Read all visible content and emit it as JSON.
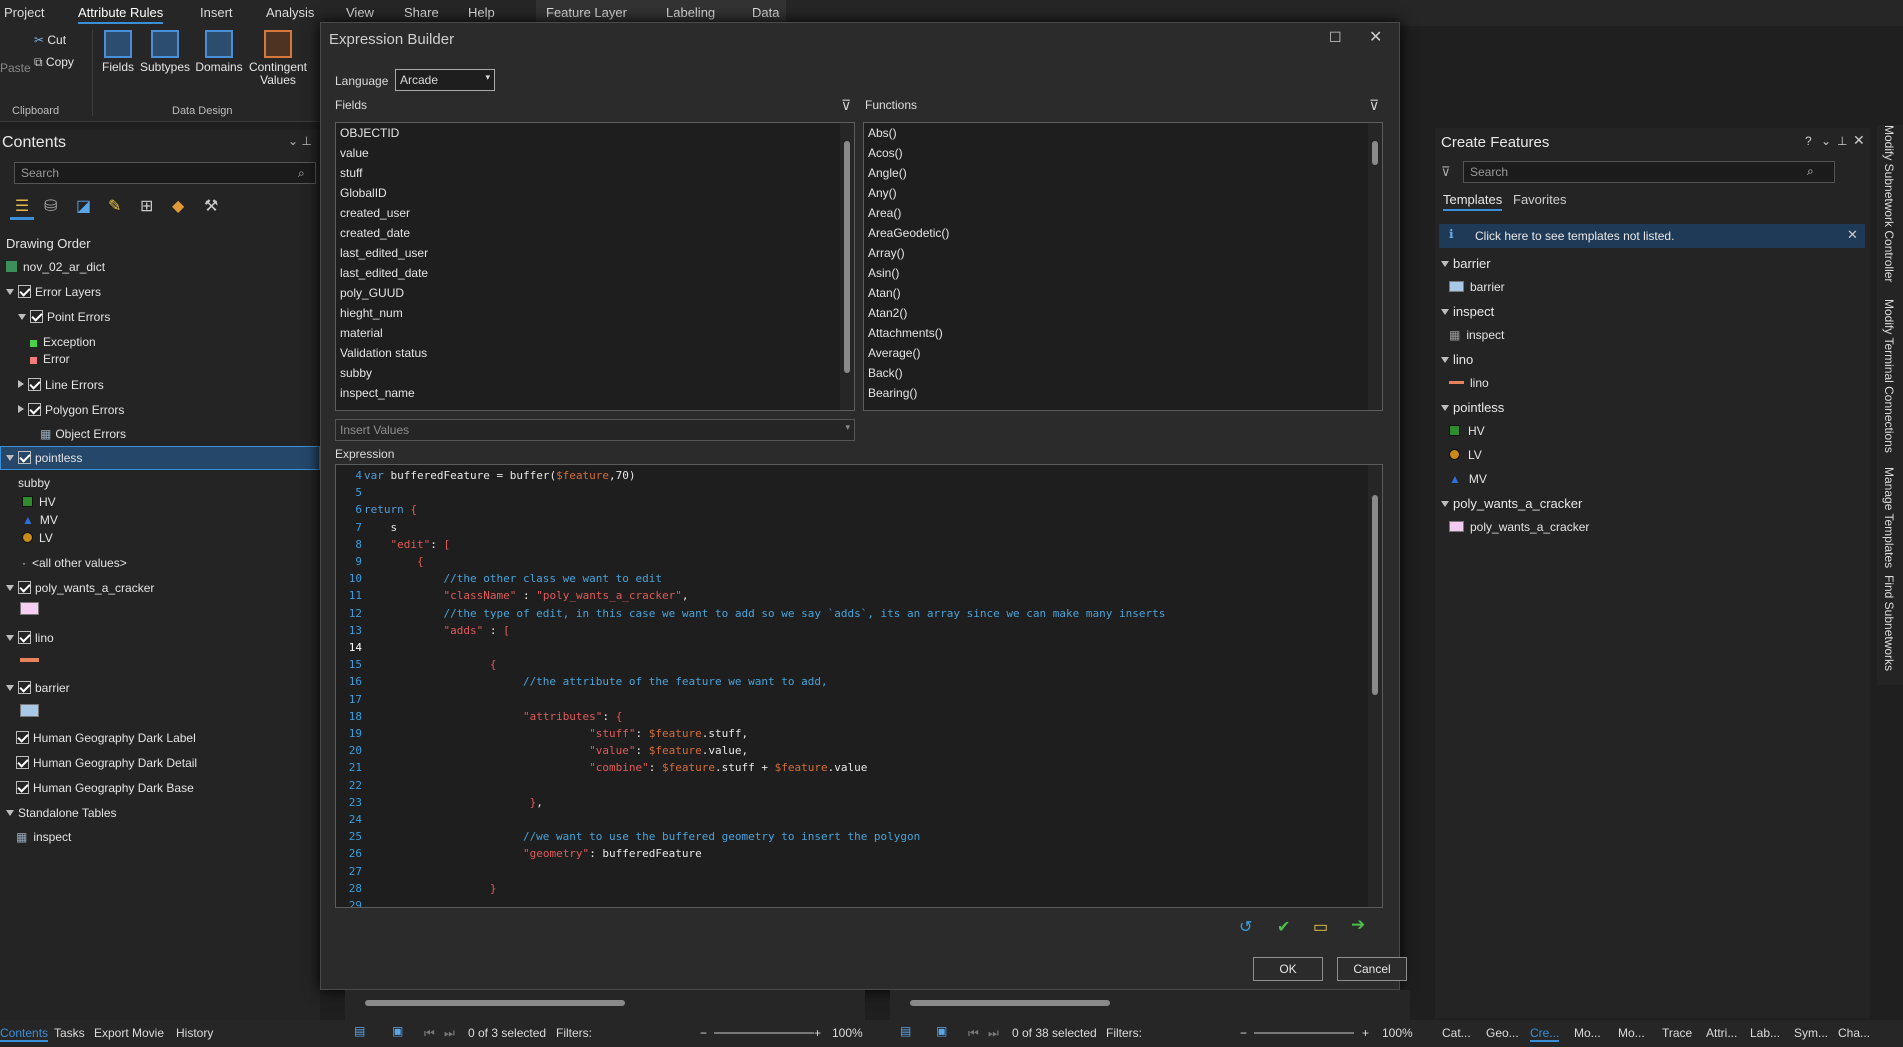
{
  "ribbon": {
    "tabs": [
      "Project",
      "Attribute Rules",
      "Insert",
      "Analysis",
      "View",
      "Share",
      "Help"
    ],
    "context_tabs": [
      "Feature Layer",
      "Labeling",
      "Data"
    ],
    "clipboard": {
      "paste": "Paste",
      "cut": "Cut",
      "copy": "Copy",
      "group": "Clipboard"
    },
    "data_design": {
      "fields": "Fields",
      "subtypes": "Subtypes",
      "domains": "Domains",
      "contingent": "Contingent Values",
      "group": "Data Design"
    }
  },
  "contents": {
    "title": "Contents",
    "search_placeholder": "Search",
    "drawing_order": "Drawing Order",
    "map": "nov_02_ar_dict",
    "error_layers": "Error Layers",
    "point_errors": "Point Errors",
    "exception": "Exception",
    "error": "Error",
    "line_errors": "Line Errors",
    "polygon_errors": "Polygon Errors",
    "object_errors": "Object Errors",
    "pointless": "pointless",
    "subby": "subby",
    "hv": "HV",
    "mv": "MV",
    "lv": "LV",
    "all_other": "<all other values>",
    "poly": "poly_wants_a_cracker",
    "lino": "lino",
    "barrier": "barrier",
    "hg_label": "Human Geography Dark Label",
    "hg_detail": "Human Geography Dark Detail",
    "hg_base": "Human Geography Dark Base",
    "standalone": "Standalone Tables",
    "inspect": "inspect"
  },
  "dialog": {
    "title": "Expression Builder",
    "language_label": "Language",
    "language_value": "Arcade",
    "fields_label": "Fields",
    "functions_label": "Functions",
    "fields": [
      "OBJECTID",
      "value",
      "stuff",
      "GlobalID",
      "created_user",
      "created_date",
      "last_edited_user",
      "last_edited_date",
      "poly_GUUD",
      "hieght_num",
      "material",
      "Validation status",
      "subby",
      "inspect_name"
    ],
    "functions": [
      "Abs()",
      "Acos()",
      "Angle()",
      "Any()",
      "Area()",
      "AreaGeodetic()",
      "Array()",
      "Asin()",
      "Atan()",
      "Atan2()",
      "Attachments()",
      "Average()",
      "Back()",
      "Bearing()"
    ],
    "insert_values_placeholder": "Insert Values",
    "expression_label": "Expression",
    "code": [
      {
        "n": "4",
        "t": "var bufferedFeature = buffer($feature,70)"
      },
      {
        "n": "5",
        "t": ""
      },
      {
        "n": "6",
        "t": "return {"
      },
      {
        "n": "7",
        "t": "    s"
      },
      {
        "n": "8",
        "t": "    \"edit\": ["
      },
      {
        "n": "9",
        "t": "        {"
      },
      {
        "n": "10",
        "t": "            //the other class we want to edit"
      },
      {
        "n": "11",
        "t": "            \"className\" : \"poly_wants_a_cracker\","
      },
      {
        "n": "12",
        "t": "            //the type of edit, in this case we want to add so we say `adds`, its an array since we can make many inserts"
      },
      {
        "n": "13",
        "t": "            \"adds\" : ["
      },
      {
        "n": "14",
        "t": ""
      },
      {
        "n": "15",
        "t": "                   {"
      },
      {
        "n": "16",
        "t": "                        //the attribute of the feature we want to add,"
      },
      {
        "n": "17",
        "t": ""
      },
      {
        "n": "18",
        "t": "                        \"attributes\": {"
      },
      {
        "n": "19",
        "t": "                                  \"stuff\": $feature.stuff,"
      },
      {
        "n": "20",
        "t": "                                  \"value\": $feature.value,"
      },
      {
        "n": "21",
        "t": "                                  \"combine\": $feature.stuff + $feature.value"
      },
      {
        "n": "22",
        "t": ""
      },
      {
        "n": "23",
        "t": "                         },"
      },
      {
        "n": "24",
        "t": ""
      },
      {
        "n": "25",
        "t": "                        //we want to use the buffered geometry to insert the polygon"
      },
      {
        "n": "26",
        "t": "                        \"geometry\": bufferedFeature"
      },
      {
        "n": "27",
        "t": ""
      },
      {
        "n": "28",
        "t": "                   }"
      },
      {
        "n": "29",
        "t": ""
      }
    ],
    "ok": "OK",
    "cancel": "Cancel"
  },
  "create_features": {
    "title": "Create Features",
    "search_placeholder": "Search",
    "tab_templates": "Templates",
    "tab_favorites": "Favorites",
    "info": "Click here to see templates not listed.",
    "groups": [
      {
        "name": "barrier",
        "items": [
          {
            "label": "barrier",
            "icon": "polygon-swatch",
            "color": "#a9c7e6"
          }
        ]
      },
      {
        "name": "inspect",
        "items": [
          {
            "label": "inspect",
            "icon": "table-icon",
            "color": "#9a9a9a"
          }
        ]
      },
      {
        "name": "lino",
        "items": [
          {
            "label": "lino",
            "icon": "line-swatch",
            "color": "#e8825a"
          }
        ]
      },
      {
        "name": "pointless",
        "items": [
          {
            "label": "HV",
            "icon": "square-marker",
            "color": "#2e8b2e"
          },
          {
            "label": "LV",
            "icon": "circle-marker",
            "color": "#c98a1a"
          },
          {
            "label": "MV",
            "icon": "triangle-marker",
            "color": "#2f6fd8"
          }
        ]
      },
      {
        "name": "poly_wants_a_cracker",
        "items": [
          {
            "label": "poly_wants_a_cracker",
            "icon": "polygon-swatch",
            "color": "#f2c9f0"
          }
        ]
      }
    ]
  },
  "side_tabs": [
    "Modify Subnetwork Controller",
    "Modify Terminal Connections",
    "Manage Templates",
    "Find Subnetworks"
  ],
  "bottom": {
    "left_tabs": [
      "Contents",
      "Tasks",
      "Export Movie",
      "History"
    ],
    "table1": {
      "selected": "0 of 3 selected",
      "filters": "Filters:",
      "zoom": "100%"
    },
    "table2": {
      "selected": "0 of 38 selected",
      "filters": "Filters:",
      "zoom": "100%"
    },
    "right_tabs": [
      "Cat...",
      "Geo...",
      "Cre...",
      "Mo...",
      "Mo...",
      "Trace",
      "Attri...",
      "Lab...",
      "Sym...",
      "Cha..."
    ]
  }
}
